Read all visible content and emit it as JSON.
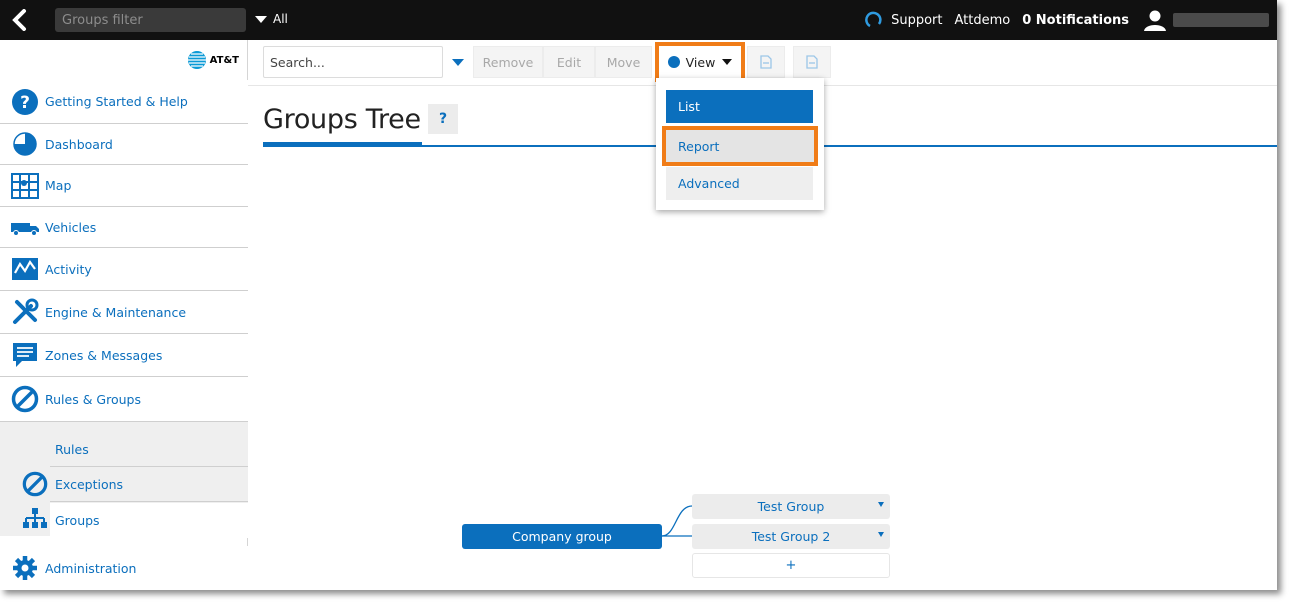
{
  "topbar": {
    "filter_placeholder": "Groups filter",
    "scope_label": "All",
    "support_label": "Support",
    "account_label": "Attdemo",
    "notifications_label": "0 Notifications"
  },
  "sidebar": {
    "logo_text": "AT&T",
    "items": [
      {
        "label": "Getting Started & Help",
        "icon": "help-circle-icon"
      },
      {
        "label": "Dashboard",
        "icon": "pie-chart-icon"
      },
      {
        "label": "Map",
        "icon": "map-icon"
      },
      {
        "label": "Vehicles",
        "icon": "truck-icon"
      },
      {
        "label": "Activity",
        "icon": "activity-icon"
      },
      {
        "label": "Engine & Maintenance",
        "icon": "tools-icon"
      },
      {
        "label": "Zones & Messages",
        "icon": "message-icon"
      },
      {
        "label": "Rules & Groups",
        "icon": "prohibited-icon"
      }
    ],
    "sub_items": [
      {
        "label": "Rules"
      },
      {
        "label": "Exceptions",
        "icon": "prohibited-icon"
      },
      {
        "label": "Groups",
        "icon": "org-chart-icon"
      }
    ],
    "admin": {
      "label": "Administration",
      "icon": "gear-icon"
    }
  },
  "toolbar": {
    "search_placeholder": "Search...",
    "remove_label": "Remove",
    "edit_label": "Edit",
    "move_label": "Move",
    "view_label": "View"
  },
  "page": {
    "title": "Groups Tree",
    "help_label": "?"
  },
  "view_menu": {
    "items": [
      "List",
      "Report",
      "Advanced"
    ]
  },
  "tree": {
    "root": "Company group",
    "children": [
      "Test Group",
      "Test Group 2"
    ],
    "add_label": "+"
  },
  "colors": {
    "accent": "#0b6fbd",
    "highlight": "#f07c17",
    "topbar": "#111111"
  }
}
